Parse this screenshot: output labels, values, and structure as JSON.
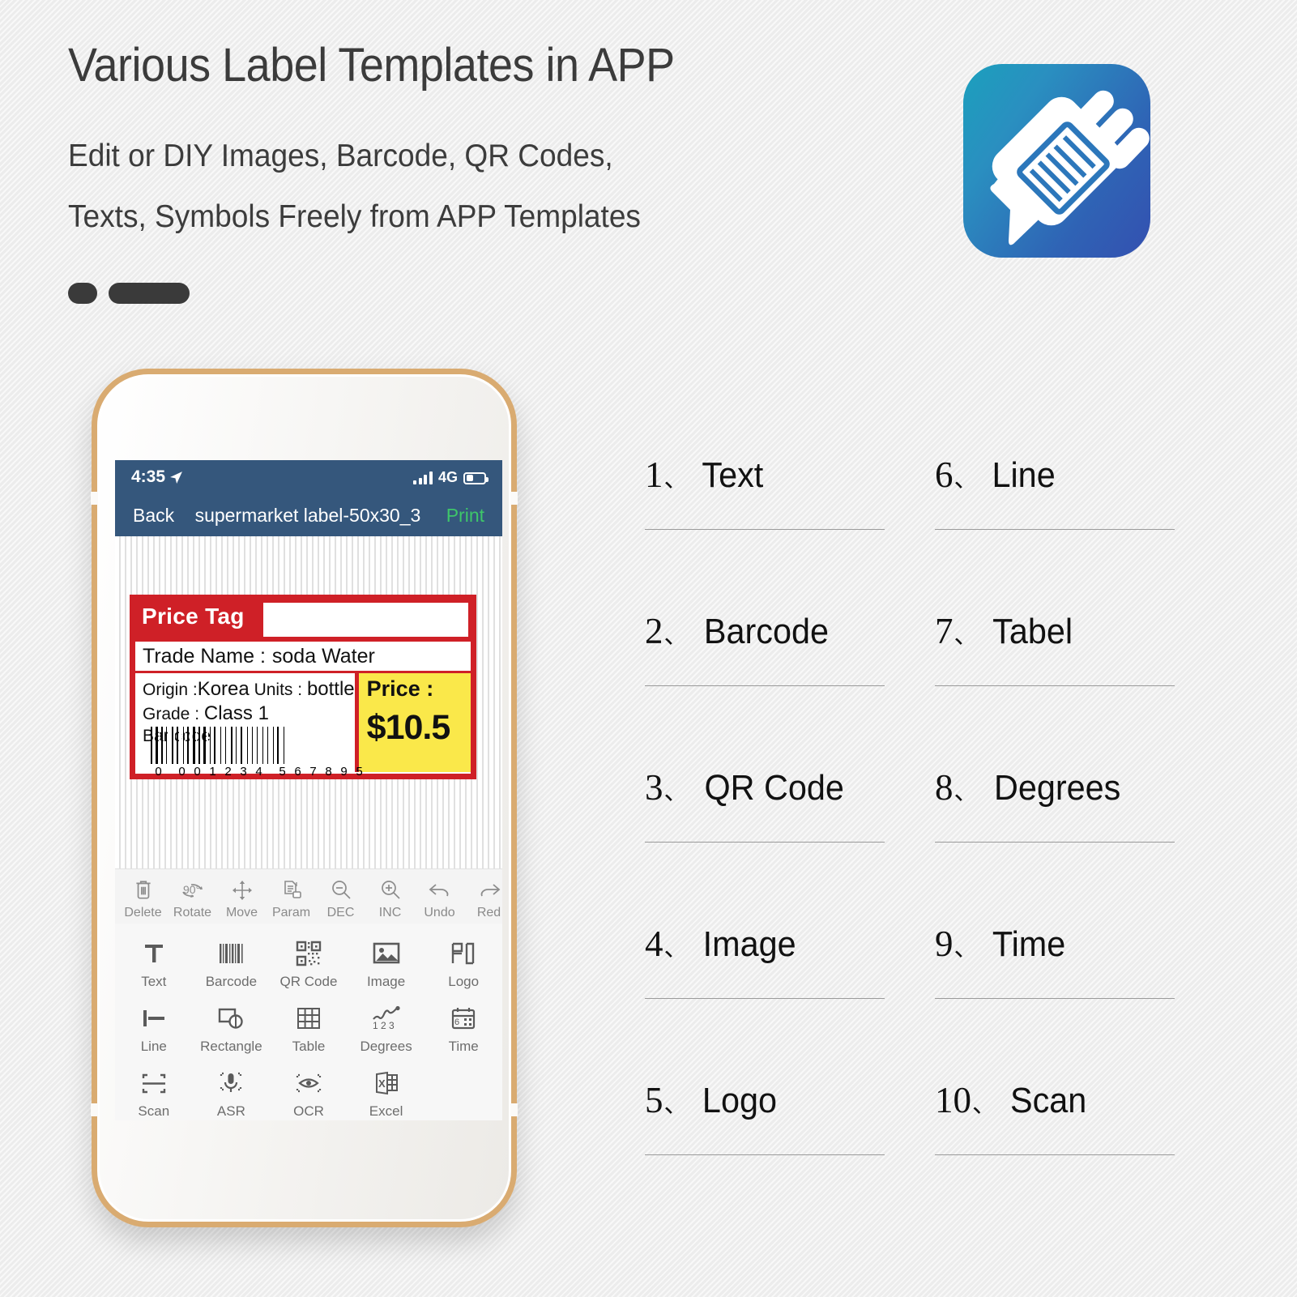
{
  "hero": {
    "title": "Various Label Templates in APP",
    "subtitle_line1": "Edit or DIY Images, Barcode, QR Codes,",
    "subtitle_line2": "Texts, Symbols Freely from APP Templates"
  },
  "app_icon": {
    "name": "label-pen-app-icon",
    "gradient_from": "#1ba0bd",
    "gradient_to": "#3450b0"
  },
  "phone": {
    "frame_color": "#d9ab71",
    "status_bar": {
      "time": "4:35",
      "location_icon": "location-arrow-icon",
      "signal_icon": "signal-bars-icon",
      "network": "4G",
      "battery_icon": "battery-icon"
    },
    "nav_bar": {
      "back_label": "Back",
      "title": "supermarket label-50x30_3",
      "print_label": "Print",
      "bar_color": "#35577c",
      "print_color": "#3ec66a"
    },
    "label_preview": {
      "header_title": "Price Tag",
      "trade_name_key": "Trade Name :",
      "trade_name_value": "soda Water",
      "origin_key": "Origin :",
      "origin_value": "Korea",
      "units_key": "Units :",
      "units_value": "bottle",
      "grade_key": "Grade :",
      "grade_value": "Class 1",
      "barcode_key": "Bar code :",
      "barcode_digits": "0 001234 567895",
      "price_key": "Price :",
      "price_value": "$10.5",
      "border_color": "#cf2027",
      "price_bg_color": "#fae84a"
    },
    "toolbar": [
      {
        "label": "Delete",
        "icon": "trash-icon"
      },
      {
        "label": "Rotate",
        "icon": "rotate-90-icon"
      },
      {
        "label": "Move",
        "icon": "move-arrows-icon"
      },
      {
        "label": "Param",
        "icon": "document-param-icon"
      },
      {
        "label": "DEC",
        "icon": "zoom-out-icon"
      },
      {
        "label": "INC",
        "icon": "zoom-in-icon"
      },
      {
        "label": "Undo",
        "icon": "undo-arrow-icon"
      },
      {
        "label": "Red",
        "icon": "redo-arrow-icon"
      }
    ],
    "tool_grid": [
      [
        {
          "label": "Text",
          "icon": "text-t-icon"
        },
        {
          "label": "Barcode",
          "icon": "barcode-icon"
        },
        {
          "label": "QR Code",
          "icon": "qr-code-icon"
        },
        {
          "label": "Image",
          "icon": "image-picture-icon"
        },
        {
          "label": "Logo",
          "icon": "logo-seal-icon"
        }
      ],
      [
        {
          "label": "Line",
          "icon": "line-icon"
        },
        {
          "label": "Rectangle",
          "icon": "rectangle-shape-icon"
        },
        {
          "label": "Table",
          "icon": "table-grid-icon"
        },
        {
          "label": "Degrees",
          "icon": "degrees-123-icon"
        },
        {
          "label": "Time",
          "icon": "calendar-time-icon"
        }
      ],
      [
        {
          "label": "Scan",
          "icon": "scan-frame-icon"
        },
        {
          "label": "ASR",
          "icon": "microphone-icon"
        },
        {
          "label": "OCR",
          "icon": "eye-ocr-icon"
        },
        {
          "label": "Excel",
          "icon": "excel-sheet-icon"
        },
        {
          "label": "",
          "icon": ""
        }
      ]
    ]
  },
  "feature_list": [
    {
      "num": "1",
      "sep": "、",
      "label": "Text"
    },
    {
      "num": "6",
      "sep": "、",
      "label": "Line"
    },
    {
      "num": "2",
      "sep": "、",
      "label": "Barcode"
    },
    {
      "num": "7",
      "sep": "、",
      "label": "Tabel"
    },
    {
      "num": "3",
      "sep": "、",
      "label": "QR Code"
    },
    {
      "num": "8",
      "sep": "、",
      "label": "Degrees"
    },
    {
      "num": "4",
      "sep": "、",
      "label": "Image"
    },
    {
      "num": "9",
      "sep": "、",
      "label": "Time"
    },
    {
      "num": "5",
      "sep": "、",
      "label": "Logo"
    },
    {
      "num": "10",
      "sep": "、",
      "label": "Scan"
    }
  ]
}
